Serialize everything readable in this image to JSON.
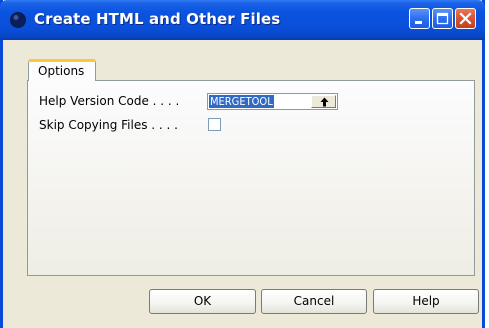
{
  "window": {
    "title": "Create HTML and Other Files",
    "icon": "app-icon",
    "controls": [
      "minimize-icon",
      "maximize-icon",
      "close-icon"
    ]
  },
  "tabs": [
    {
      "label": "Options",
      "selected": true
    }
  ],
  "form": {
    "help_version_label": "Help Version Code . . . .",
    "help_version_value": "MERGETOOL",
    "skip_copying_label": "Skip Copying Files . . . .",
    "skip_copying_checked": false
  },
  "buttons": {
    "ok": "OK",
    "cancel": "Cancel",
    "help": "Help"
  },
  "colors": {
    "titlebar": "#0a54e0",
    "selection": "#316ac5",
    "tab_accent": "#ffc83c",
    "close_button": "#d8532f"
  }
}
